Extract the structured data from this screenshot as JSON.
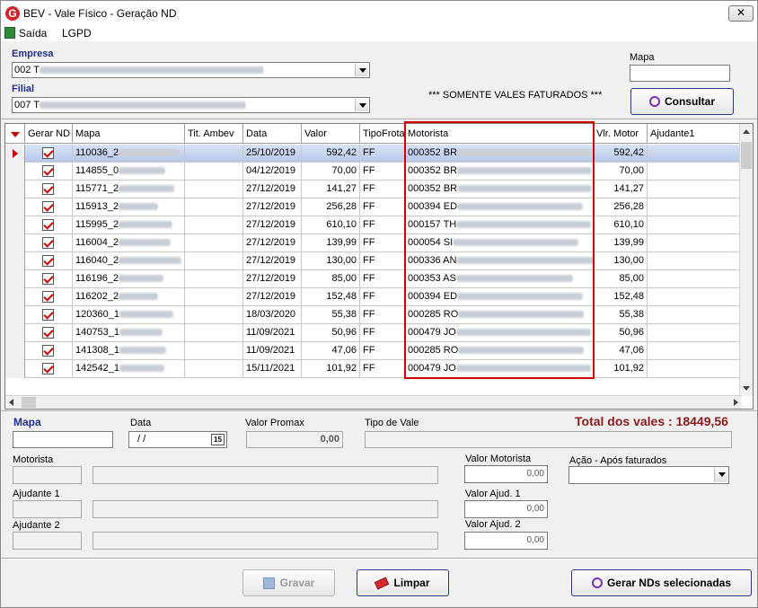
{
  "window": {
    "title": "BEV - Vale Físico - Geração ND",
    "close_glyph": "✕",
    "icon_letter": "G"
  },
  "menu": {
    "saida": "Saída",
    "lgpd": "LGPD"
  },
  "filters": {
    "empresa_label": "Empresa",
    "empresa_value": "002 T",
    "filial_label": "Filial",
    "filial_value": "007 T",
    "mapa_label": "Mapa",
    "mapa_value": "",
    "notice": "*** SOMENTE VALES FATURADOS ***",
    "consultar": "Consultar"
  },
  "grid": {
    "columns": [
      "Gerar ND",
      "Mapa",
      "Tit. Ambev",
      "Data",
      "Valor",
      "TipoFrota",
      "Motorista",
      "Vlr. Motor",
      "Ajudante1"
    ],
    "rows": [
      {
        "mapa": "110036_2",
        "data": "25/10/2019",
        "valor": "592,42",
        "tipo": "FF",
        "motorista": "000352 BR",
        "vlr": "592,42"
      },
      {
        "mapa": "114855_0",
        "data": "04/12/2019",
        "valor": "70,00",
        "tipo": "FF",
        "motorista": "000352 BR",
        "vlr": "70,00"
      },
      {
        "mapa": "115771_2",
        "data": "27/12/2019",
        "valor": "141,27",
        "tipo": "FF",
        "motorista": "000352 BR",
        "vlr": "141,27"
      },
      {
        "mapa": "115913_2",
        "data": "27/12/2019",
        "valor": "256,28",
        "tipo": "FF",
        "motorista": "000394 ED",
        "vlr": "256,28"
      },
      {
        "mapa": "115995_2",
        "data": "27/12/2019",
        "valor": "610,10",
        "tipo": "FF",
        "motorista": "000157 TH",
        "vlr": "610,10"
      },
      {
        "mapa": "116004_2",
        "data": "27/12/2019",
        "valor": "139,99",
        "tipo": "FF",
        "motorista": "000054 SI",
        "vlr": "139,99"
      },
      {
        "mapa": "116040_2",
        "data": "27/12/2019",
        "valor": "130,00",
        "tipo": "FF",
        "motorista": "000336 AN",
        "vlr": "130,00"
      },
      {
        "mapa": "116196_2",
        "data": "27/12/2019",
        "valor": "85,00",
        "tipo": "FF",
        "motorista": "000353 AS",
        "vlr": "85,00"
      },
      {
        "mapa": "116202_2",
        "data": "27/12/2019",
        "valor": "152,48",
        "tipo": "FF",
        "motorista": "000394 ED",
        "vlr": "152,48"
      },
      {
        "mapa": "120360_1",
        "data": "18/03/2020",
        "valor": "55,38",
        "tipo": "FF",
        "motorista": "000285 RO",
        "vlr": "55,38"
      },
      {
        "mapa": "140753_1",
        "data": "11/09/2021",
        "valor": "50,96",
        "tipo": "FF",
        "motorista": "000479 JO",
        "vlr": "50,96"
      },
      {
        "mapa": "141308_1",
        "data": "11/09/2021",
        "valor": "47,06",
        "tipo": "FF",
        "motorista": "000285 RO",
        "vlr": "47,06"
      },
      {
        "mapa": "142542_1",
        "data": "15/11/2021",
        "valor": "101,92",
        "tipo": "FF",
        "motorista": "000479 JO",
        "vlr": "101,92"
      }
    ]
  },
  "detail": {
    "mapa_label": "Mapa",
    "data_label": "Data",
    "data_value": "/ /",
    "calendar": "15",
    "valor_promax_label": "Valor Promax",
    "valor_promax": "0,00",
    "tipo_vale_label": "Tipo de Vale",
    "total": "Total dos vales : 18449,56",
    "motorista_label": "Motorista",
    "ajudante1_label": "Ajudante 1",
    "ajudante2_label": "Ajudante 2",
    "valor_motorista_label": "Valor Motorista",
    "valor_motorista": "0,00",
    "valor_ajud1_label": "Valor Ajud. 1",
    "valor_ajud1": "0,00",
    "valor_ajud2_label": "Valor Ajud. 2",
    "valor_ajud2": "0,00",
    "acao_label": "Ação - Após faturados"
  },
  "buttons": {
    "gravar": "Gravar",
    "limpar": "Limpar",
    "gerar": "Gerar NDs selecionadas"
  },
  "colors": {
    "highlight": "#d40000",
    "label_blue": "#1f2e8c",
    "total_red": "#8b1a1a"
  }
}
